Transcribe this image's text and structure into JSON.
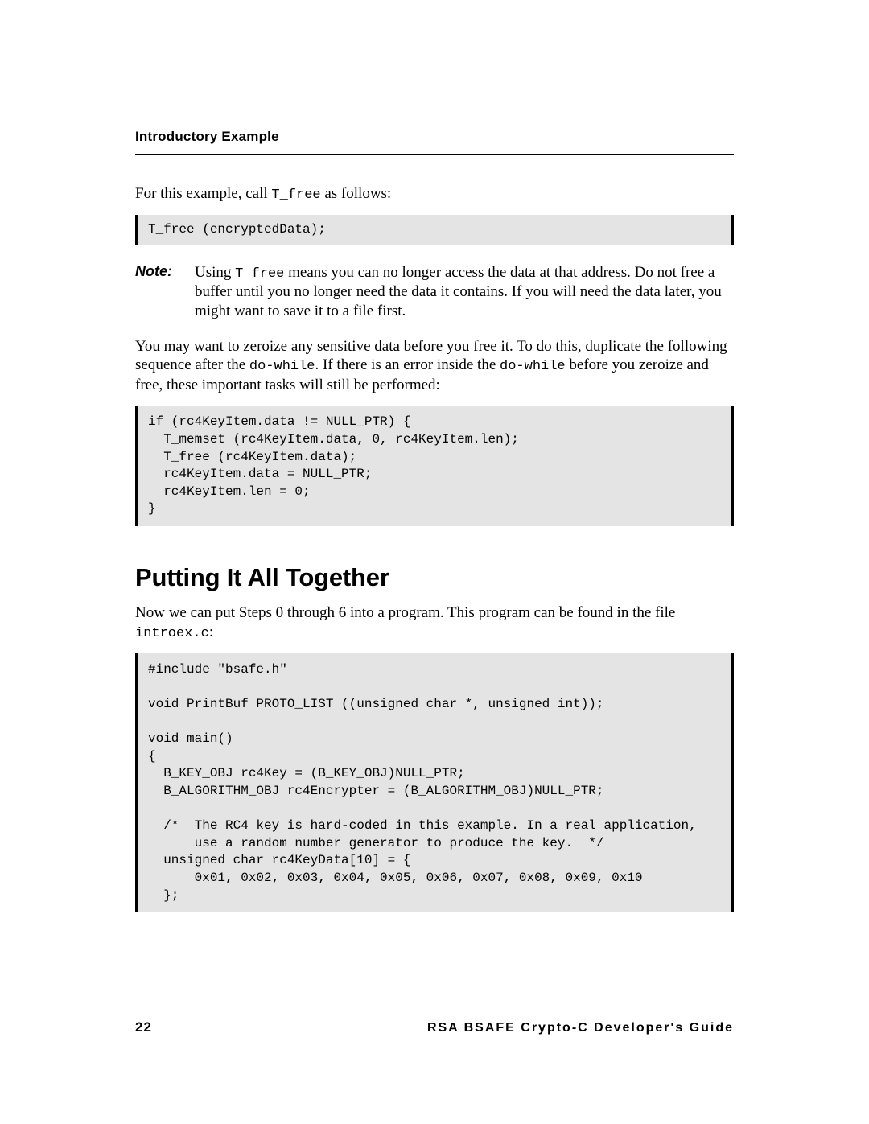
{
  "header": {
    "running": "Introductory Example"
  },
  "intro": {
    "para1_a": "For this example, call ",
    "para1_code": "T_free",
    "para1_b": " as follows:",
    "code1": "T_free (encryptedData);"
  },
  "note": {
    "label": "Note:",
    "body_a": "Using ",
    "body_code": "T_free",
    "body_b": " means you can no longer access the data at that address. Do not free a buffer until you no longer need the data it contains. If you will need the data later, you might want to save it to a file first."
  },
  "zeroize": {
    "para_a": "You may want to zeroize any sensitive data before you free it. To do this, duplicate the following sequence after the ",
    "code1": "do-while",
    "para_b": ". If there is an error inside the ",
    "code2": "do-while",
    "para_c": " before you zeroize and free, these important tasks will still be performed:",
    "code_block": "if (rc4KeyItem.data != NULL_PTR) {\n  T_memset (rc4KeyItem.data, 0, rc4KeyItem.len);\n  T_free (rc4KeyItem.data);\n  rc4KeyItem.data = NULL_PTR;\n  rc4KeyItem.len = 0;\n}"
  },
  "together": {
    "heading": "Putting It All Together",
    "para_a": "Now we can put Steps 0 through 6 into a program. This program can be found in the file ",
    "code": "introex.c",
    "para_b": ":",
    "code_block": "#include \"bsafe.h\"\n\nvoid PrintBuf PROTO_LIST ((unsigned char *, unsigned int));\n\nvoid main()\n{\n  B_KEY_OBJ rc4Key = (B_KEY_OBJ)NULL_PTR;\n  B_ALGORITHM_OBJ rc4Encrypter = (B_ALGORITHM_OBJ)NULL_PTR;\n\n  /*  The RC4 key is hard-coded in this example. In a real application,\n      use a random number generator to produce the key.  */\n  unsigned char rc4KeyData[10] = {\n      0x01, 0x02, 0x03, 0x04, 0x05, 0x06, 0x07, 0x08, 0x09, 0x10\n  };"
  },
  "footer": {
    "page": "22",
    "guide": "RSA BSAFE Crypto-C Developer's Guide"
  }
}
